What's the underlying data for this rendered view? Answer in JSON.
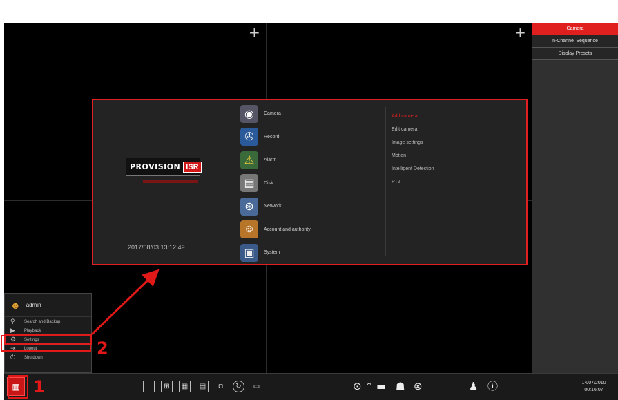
{
  "right_panel": {
    "buttons": [
      {
        "label": "Camera",
        "active": true
      },
      {
        "label": "n-Channel Sequence",
        "active": false
      },
      {
        "label": "Display Presets",
        "active": false
      }
    ]
  },
  "main_menu": {
    "datetime": "2017/08/03 13:12:49",
    "categories": [
      {
        "label": "Camera",
        "icon": "camera-icon",
        "glyph": "◉",
        "active": true
      },
      {
        "label": "Record",
        "icon": "record-icon",
        "glyph": "✇",
        "active": false
      },
      {
        "label": "Alarm",
        "icon": "alarm-icon",
        "glyph": "⚠",
        "active": false
      },
      {
        "label": "Disk",
        "icon": "disk-icon",
        "glyph": "▤",
        "active": false
      },
      {
        "label": "Network",
        "icon": "network-icon",
        "glyph": "⊛",
        "active": false
      },
      {
        "label": "Account and authority",
        "icon": "account-icon",
        "glyph": "☺",
        "active": false
      },
      {
        "label": "System",
        "icon": "system-icon",
        "glyph": "▣",
        "active": false
      }
    ],
    "subitems": [
      {
        "label": "Add camera",
        "active": true
      },
      {
        "label": "Edit camera",
        "active": false
      },
      {
        "label": "Image settings",
        "active": false
      },
      {
        "label": "Motion",
        "active": false
      },
      {
        "label": "Intelligent Detection",
        "active": false
      },
      {
        "label": "PTZ",
        "active": false
      }
    ]
  },
  "start_menu": {
    "user": "admin",
    "items": [
      {
        "label": "Search and Backup",
        "icon": "search-backup-icon",
        "glyph": "⚲"
      },
      {
        "label": "Playback",
        "icon": "playback-icon",
        "glyph": "▶"
      },
      {
        "label": "Settings",
        "icon": "settings-icon",
        "glyph": "⚙"
      },
      {
        "label": "Logout",
        "icon": "logout-icon",
        "glyph": "⇥"
      },
      {
        "label": "Shutdown",
        "icon": "shutdown-icon",
        "glyph": "⏻"
      }
    ]
  },
  "taskbar": {
    "date": "14/07/2010",
    "time": "00:16:07"
  },
  "annotations": {
    "step1": "1",
    "step2": "2"
  },
  "colors": {
    "accent": "#e01f1f",
    "screen_bg": "#000000",
    "menu_bg": "#232323"
  }
}
